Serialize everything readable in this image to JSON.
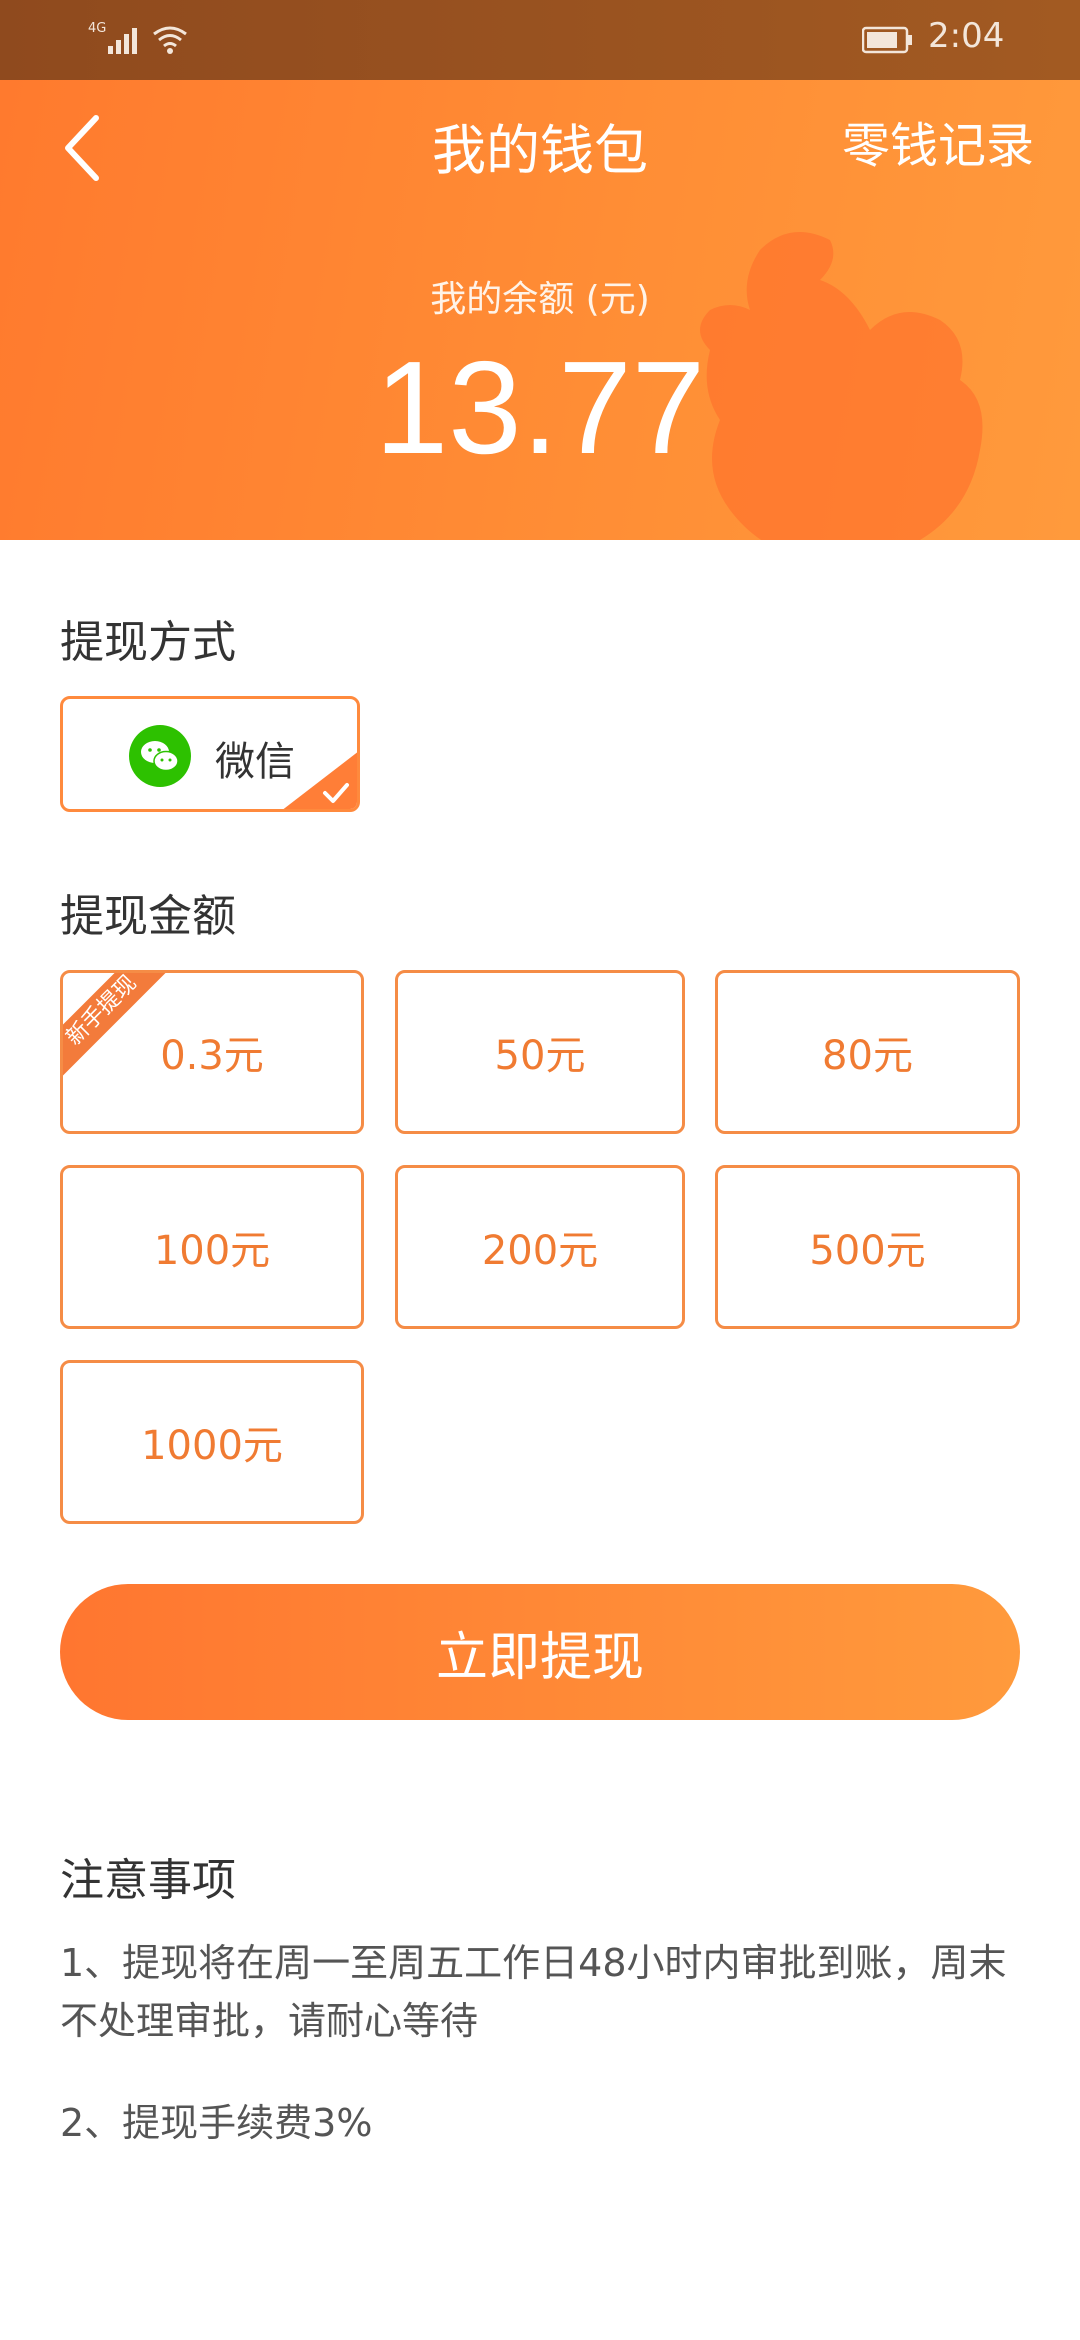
{
  "status_bar": {
    "network": "4G",
    "time": "2:04"
  },
  "header": {
    "title": "我的钱包",
    "record_link": "零钱记录",
    "balance_label": "我的余额 (元)",
    "balance": "13.77"
  },
  "withdraw_method": {
    "section_title": "提现方式",
    "method": "微信"
  },
  "withdraw_amount": {
    "section_title": "提现金额",
    "new_user_tag": "新手提现",
    "options": [
      "0.3元",
      "50元",
      "80元",
      "100元",
      "200元",
      "500元",
      "1000元"
    ]
  },
  "action": {
    "submit_label": "立即提现"
  },
  "notes": {
    "title": "注意事项",
    "items": [
      "1、提现将在周一至周五工作日48小时内审批到账，周末不处理审批，请耐心等待",
      "2、提现手续费3%"
    ]
  },
  "colors": {
    "accent": "#ff8a3d",
    "amount_text": "#f07b32",
    "header_start": "#ff7a2e",
    "header_end": "#ff9a3c"
  }
}
